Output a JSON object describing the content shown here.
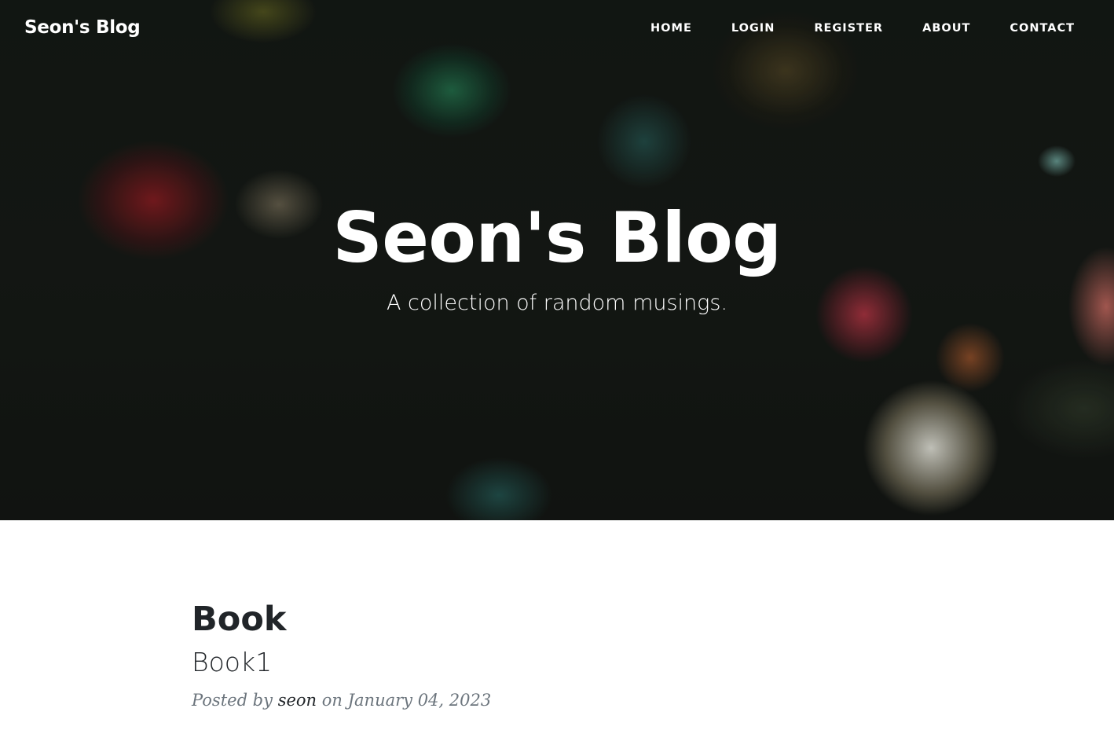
{
  "navbar": {
    "brand": "Seon's Blog",
    "links": [
      "HOME",
      "LOGIN",
      "REGISTER",
      "ABOUT",
      "CONTACT"
    ]
  },
  "hero": {
    "title": "Seon's Blog",
    "subtitle": "A collection of random musings."
  },
  "posts": [
    {
      "title": "Book",
      "subtitle": "Book1",
      "meta_prefix": "Posted by",
      "author": "seon",
      "meta_on": "on",
      "date": "January 04, 2023"
    }
  ]
}
